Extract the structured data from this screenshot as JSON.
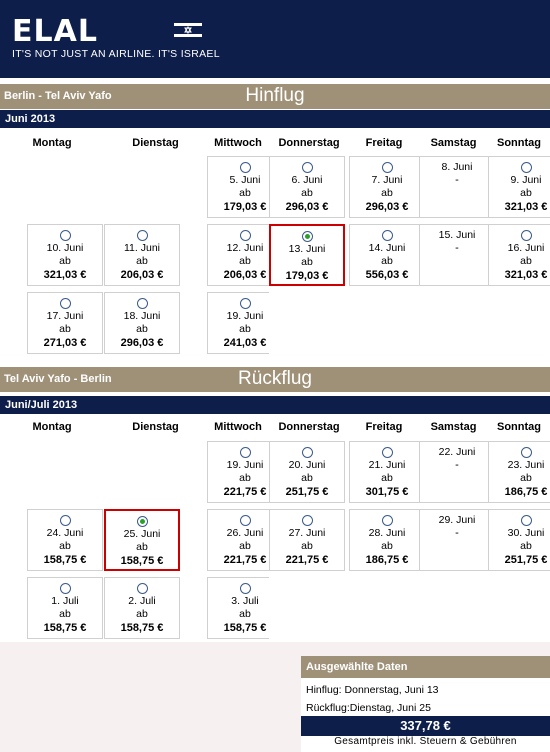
{
  "header": {
    "logo_text": "ELAL",
    "tagline": "IT'S NOT JUST AN AIRLINE. IT'S ISRAEL"
  },
  "weekdays": [
    "Montag",
    "Dienstag",
    "Mittwoch",
    "Donnerstag",
    "Freitag",
    "Samstag",
    "Sonntag"
  ],
  "outbound": {
    "route": "Berlin - Tel Aviv Yafo",
    "title": "Hinflug",
    "month": "Juni 2013",
    "rows": [
      [
        null,
        null,
        {
          "date": "5. Juni",
          "ab": "ab",
          "price": "179,03 €",
          "available": true
        },
        {
          "date": "6. Juni",
          "ab": "ab",
          "price": "296,03 €",
          "available": true
        },
        {
          "date": "7. Juni",
          "ab": "ab",
          "price": "296,03 €",
          "available": true
        },
        {
          "date": "8. Juni",
          "dash": "-",
          "available": false
        },
        {
          "date": "9. Juni",
          "ab": "ab",
          "price": "321,03 €",
          "available": true
        }
      ],
      [
        {
          "date": "10. Juni",
          "ab": "ab",
          "price": "321,03 €",
          "available": true
        },
        {
          "date": "11. Juni",
          "ab": "ab",
          "price": "206,03 €",
          "available": true
        },
        {
          "date": "12. Juni",
          "ab": "ab",
          "price": "206,03 €",
          "available": true
        },
        {
          "date": "13. Juni",
          "ab": "ab",
          "price": "179,03 €",
          "available": true,
          "selected": true
        },
        {
          "date": "14. Juni",
          "ab": "ab",
          "price": "556,03 €",
          "available": true
        },
        {
          "date": "15. Juni",
          "dash": "-",
          "available": false
        },
        {
          "date": "16. Juni",
          "ab": "ab",
          "price": "321,03 €",
          "available": true
        }
      ],
      [
        {
          "date": "17. Juni",
          "ab": "ab",
          "price": "271,03 €",
          "available": true
        },
        {
          "date": "18. Juni",
          "ab": "ab",
          "price": "296,03 €",
          "available": true
        },
        {
          "date": "19. Juni",
          "ab": "ab",
          "price": "241,03 €",
          "available": true
        },
        null,
        null,
        null,
        null
      ]
    ]
  },
  "return": {
    "route": "Tel Aviv Yafo - Berlin",
    "title": "Rückflug",
    "month": "Juni/Juli 2013",
    "rows": [
      [
        null,
        null,
        {
          "date": "19. Juni",
          "ab": "ab",
          "price": "221,75 €",
          "available": true
        },
        {
          "date": "20. Juni",
          "ab": "ab",
          "price": "251,75 €",
          "available": true
        },
        {
          "date": "21. Juni",
          "ab": "ab",
          "price": "301,75 €",
          "available": true
        },
        {
          "date": "22. Juni",
          "dash": "-",
          "available": false
        },
        {
          "date": "23. Juni",
          "ab": "ab",
          "price": "186,75 €",
          "available": true
        }
      ],
      [
        {
          "date": "24. Juni",
          "ab": "ab",
          "price": "158,75 €",
          "available": true
        },
        {
          "date": "25. Juni",
          "ab": "ab",
          "price": "158,75 €",
          "available": true,
          "selected": true
        },
        {
          "date": "26. Juni",
          "ab": "ab",
          "price": "221,75 €",
          "available": true
        },
        {
          "date": "27. Juni",
          "ab": "ab",
          "price": "221,75 €",
          "available": true
        },
        {
          "date": "28. Juni",
          "ab": "ab",
          "price": "186,75 €",
          "available": true
        },
        {
          "date": "29. Juni",
          "dash": "-",
          "available": false
        },
        {
          "date": "30. Juni",
          "ab": "ab",
          "price": "251,75 €",
          "available": true
        }
      ],
      [
        {
          "date": "1. Juli",
          "ab": "ab",
          "price": "158,75 €",
          "available": true
        },
        {
          "date": "2. Juli",
          "ab": "ab",
          "price": "158,75 €",
          "available": true
        },
        {
          "date": "3. Juli",
          "ab": "ab",
          "price": "158,75 €",
          "available": true
        },
        null,
        null,
        null,
        null
      ]
    ]
  },
  "summary": {
    "title": "Ausgewählte Daten",
    "outbound_line": "Hinflug: Donnerstag, Juni 13",
    "return_line": "Rückflug:Dienstag, Juni 25",
    "total": "337,78 €",
    "note": "Gesamtpreis inkl. Steuern & Gebühren"
  },
  "colors": {
    "navy": "#0d1e4a",
    "tan": "#9f9178",
    "selected_border": "#cc0000",
    "radio_checked": "#2aa02a"
  }
}
